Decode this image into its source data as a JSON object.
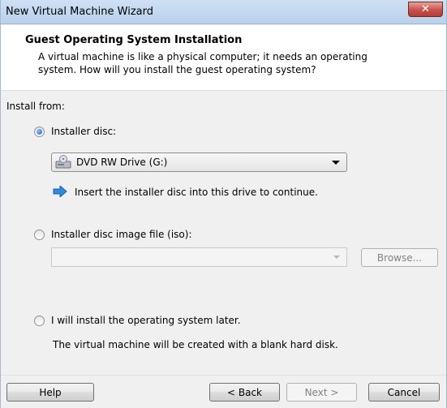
{
  "window": {
    "title": "New Virtual Machine Wizard"
  },
  "header": {
    "title": "Guest Operating System Installation",
    "description_line1": "A virtual machine is like a physical computer; it needs an operating",
    "description_line2": "system. How will you install the guest operating system?"
  },
  "install": {
    "section_label": "Install from:",
    "selected_option": "Installer disc:",
    "disc": {
      "label": "Installer disc:",
      "drive_selected": "DVD RW Drive (G:)",
      "info": "Insert the installer disc into this drive to continue."
    },
    "iso": {
      "label": "Installer disc image file (iso):",
      "value": "",
      "browse_label": "Browse..."
    },
    "later": {
      "label": "I will install the operating system later.",
      "note": "The virtual machine will be created with a blank hard disk."
    }
  },
  "footer": {
    "help_label": "Help",
    "back_label": "< Back",
    "next_label": "Next >",
    "cancel_label": "Cancel"
  },
  "colors": {
    "selected_radio": "#1a5fb4",
    "info_arrow": "#2f8be0",
    "close_button": "#c75050"
  },
  "icons": {
    "close": "close-icon",
    "drive": "dvd-drive-icon",
    "info": "blue-arrow-icon",
    "dropdown": "chevron-down-icon"
  }
}
